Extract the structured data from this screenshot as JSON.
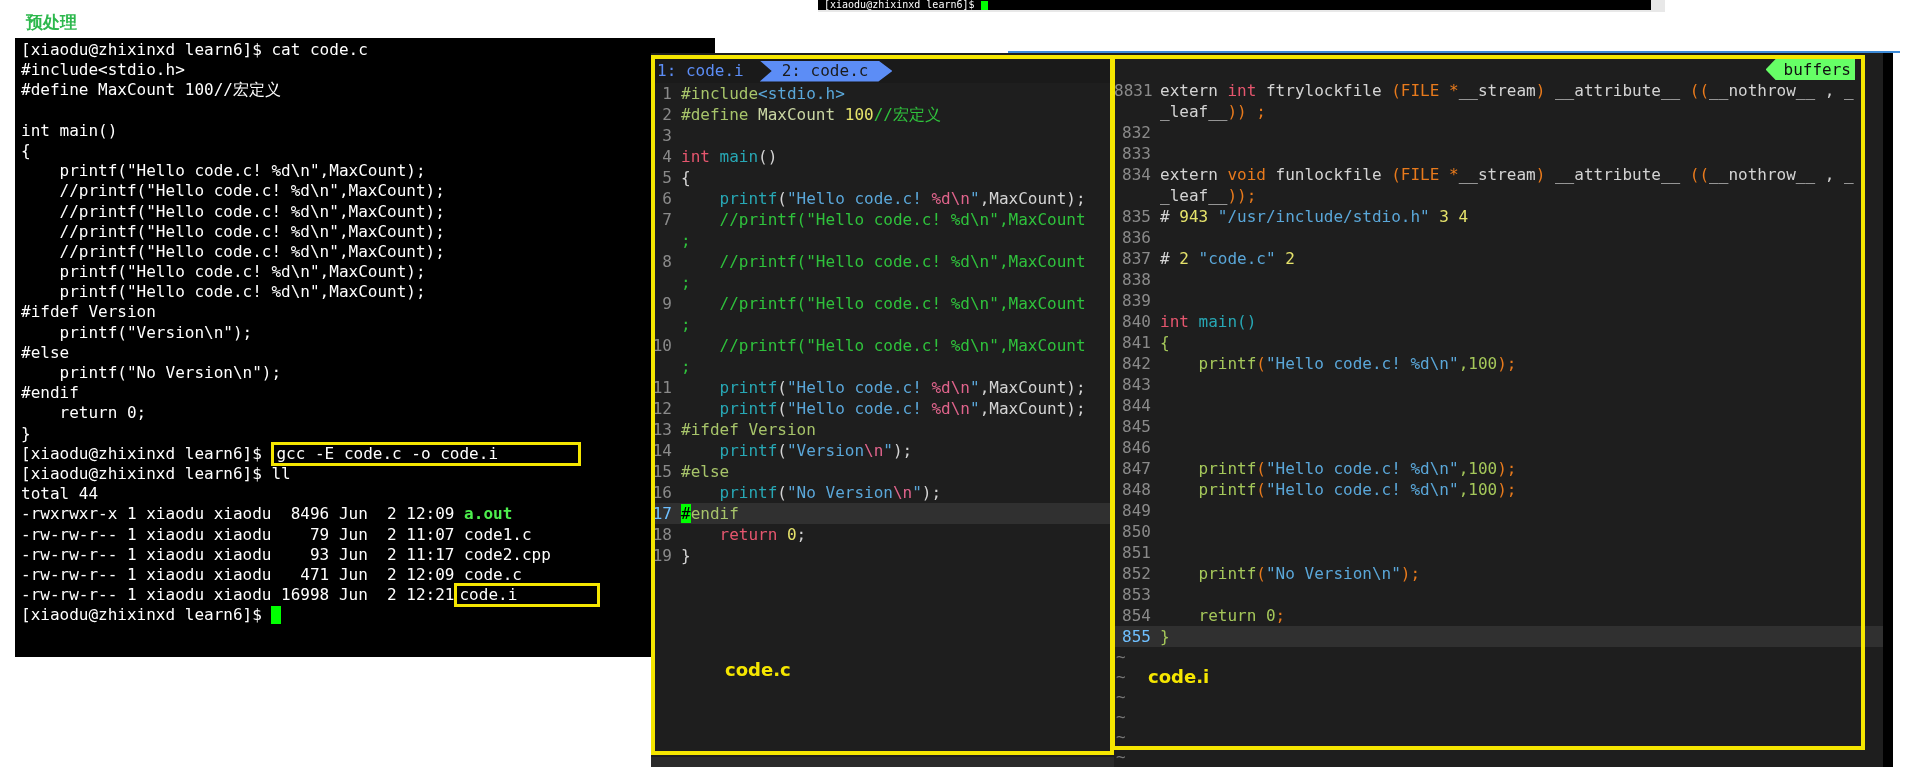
{
  "heading": "预处理",
  "top_terminal": {
    "prompt": "[xiaodu@zhixinxd learn6]$",
    "cursor": true
  },
  "terminal": {
    "lines": [
      {
        "kind": "text",
        "parts": [
          {
            "kind": "plain",
            "text": "[xiaodu@zhixinxd learn6]$ cat code.c"
          }
        ]
      },
      {
        "kind": "text",
        "parts": [
          {
            "kind": "plain",
            "text": "#include<stdio.h>"
          }
        ]
      },
      {
        "kind": "text",
        "parts": [
          {
            "kind": "plain",
            "text": "#define MaxCount 100//宏定义"
          }
        ]
      },
      {
        "kind": "blank"
      },
      {
        "kind": "text",
        "parts": [
          {
            "kind": "plain",
            "text": "int main()"
          }
        ]
      },
      {
        "kind": "text",
        "parts": [
          {
            "kind": "plain",
            "text": "{"
          }
        ]
      },
      {
        "kind": "text",
        "parts": [
          {
            "kind": "plain",
            "text": "    printf(\"Hello code.c! %d\\n\",MaxCount);"
          }
        ]
      },
      {
        "kind": "text",
        "parts": [
          {
            "kind": "plain",
            "text": "    //printf(\"Hello code.c! %d\\n\",MaxCount);"
          }
        ]
      },
      {
        "kind": "text",
        "parts": [
          {
            "kind": "plain",
            "text": "    //printf(\"Hello code.c! %d\\n\",MaxCount);"
          }
        ]
      },
      {
        "kind": "text",
        "parts": [
          {
            "kind": "plain",
            "text": "    //printf(\"Hello code.c! %d\\n\",MaxCount);"
          }
        ]
      },
      {
        "kind": "text",
        "parts": [
          {
            "kind": "plain",
            "text": "    //printf(\"Hello code.c! %d\\n\",MaxCount);"
          }
        ]
      },
      {
        "kind": "text",
        "parts": [
          {
            "kind": "plain",
            "text": "    printf(\"Hello code.c! %d\\n\",MaxCount);"
          }
        ]
      },
      {
        "kind": "text",
        "parts": [
          {
            "kind": "plain",
            "text": "    printf(\"Hello code.c! %d\\n\",MaxCount);"
          }
        ]
      },
      {
        "kind": "text",
        "parts": [
          {
            "kind": "plain",
            "text": "#ifdef Version"
          }
        ]
      },
      {
        "kind": "text",
        "parts": [
          {
            "kind": "plain",
            "text": "    printf(\"Version\\n\");"
          }
        ]
      },
      {
        "kind": "text",
        "parts": [
          {
            "kind": "plain",
            "text": "#else"
          }
        ]
      },
      {
        "kind": "text",
        "parts": [
          {
            "kind": "plain",
            "text": "    printf(\"No Version\\n\");"
          }
        ]
      },
      {
        "kind": "text",
        "parts": [
          {
            "kind": "plain",
            "text": "#endif"
          }
        ]
      },
      {
        "kind": "text",
        "parts": [
          {
            "kind": "plain",
            "text": "    return 0;"
          }
        ]
      },
      {
        "kind": "text",
        "parts": [
          {
            "kind": "plain",
            "text": "}"
          }
        ]
      },
      {
        "kind": "text",
        "parts": [
          {
            "kind": "plain",
            "text": "[xiaodu@zhixinxd learn6]$ "
          },
          {
            "kind": "boxed",
            "text": "gcc -E code.c -o code.i"
          }
        ]
      },
      {
        "kind": "text",
        "parts": [
          {
            "kind": "plain",
            "text": "[xiaodu@zhixinxd learn6]$ ll"
          }
        ]
      },
      {
        "kind": "text",
        "parts": [
          {
            "kind": "plain",
            "text": "total 44"
          }
        ]
      },
      {
        "kind": "text",
        "parts": [
          {
            "kind": "plain",
            "text": "-rwxrwxr-x 1 xiaodu xiaodu  8496 Jun  2 12:09 "
          },
          {
            "kind": "executable",
            "text": "a.out"
          }
        ]
      },
      {
        "kind": "text",
        "parts": [
          {
            "kind": "plain",
            "text": "-rw-rw-r-- 1 xiaodu xiaodu    79 Jun  2 11:07 code1.c"
          }
        ]
      },
      {
        "kind": "text",
        "parts": [
          {
            "kind": "plain",
            "text": "-rw-rw-r-- 1 xiaodu xiaodu    93 Jun  2 11:17 code2.cpp"
          }
        ]
      },
      {
        "kind": "text",
        "parts": [
          {
            "kind": "plain",
            "text": "-rw-rw-r-- 1 xiaodu xiaodu   471 Jun  2 12:09 code.c"
          }
        ]
      },
      {
        "kind": "text",
        "parts": [
          {
            "kind": "plain",
            "text": "-rw-rw-r-- 1 xiaodu xiaodu 16998 Jun  2 12:21"
          },
          {
            "kind": "boxed",
            "text": "code.i"
          }
        ]
      },
      {
        "kind": "text",
        "cursor": true,
        "parts": [
          {
            "kind": "plain",
            "text": "[xiaodu@zhixinxd learn6]$ "
          }
        ]
      }
    ]
  },
  "code_editor": {
    "tabs": [
      {
        "label": "1: code.i",
        "selected": false
      },
      {
        "label": "2: code.c",
        "selected": true
      }
    ],
    "lines": [
      {
        "kind": "line",
        "number": "1",
        "current": false,
        "tokens": [
          {
            "kind": "preproc",
            "text": "#include"
          },
          {
            "kind": "string",
            "text": "<stdio.h>"
          }
        ]
      },
      {
        "kind": "line",
        "number": "2",
        "current": false,
        "tokens": [
          {
            "kind": "preproc",
            "text": "#define "
          },
          {
            "kind": "macro",
            "text": "MaxCount "
          },
          {
            "kind": "number",
            "text": "100"
          },
          {
            "kind": "comment",
            "text": "//宏定义"
          }
        ]
      },
      {
        "kind": "line",
        "number": "3",
        "current": false
      },
      {
        "kind": "line",
        "number": "4",
        "current": false,
        "tokens": [
          {
            "kind": "type",
            "text": "int "
          },
          {
            "kind": "func",
            "text": "main"
          },
          {
            "kind": "plain",
            "text": "()"
          }
        ]
      },
      {
        "kind": "line",
        "number": "5",
        "current": false,
        "tokens": [
          {
            "kind": "plain",
            "text": "{"
          }
        ]
      },
      {
        "kind": "line",
        "number": "6",
        "current": false,
        "tokens": [
          {
            "kind": "func",
            "text": "    printf"
          },
          {
            "kind": "plain",
            "text": "("
          },
          {
            "kind": "string",
            "text": "\"Hello code.c! "
          },
          {
            "kind": "escape",
            "text": "%d\\n"
          },
          {
            "kind": "string",
            "text": "\""
          },
          {
            "kind": "plain",
            "text": ",MaxCount);"
          }
        ]
      },
      {
        "kind": "line",
        "number": "7",
        "current": false,
        "tokens": [
          {
            "kind": "comment",
            "text": "    //printf(\"Hello code.c! %d\\n\",MaxCount"
          }
        ]
      },
      {
        "kind": "wrap",
        "current": false,
        "tokens": [
          {
            "kind": "comment",
            "text": ";"
          }
        ]
      },
      {
        "kind": "line",
        "number": "8",
        "current": false,
        "tokens": [
          {
            "kind": "comment",
            "text": "    //printf(\"Hello code.c! %d\\n\",MaxCount"
          }
        ]
      },
      {
        "kind": "wrap",
        "current": false,
        "tokens": [
          {
            "kind": "comment",
            "text": ";"
          }
        ]
      },
      {
        "kind": "line",
        "number": "9",
        "current": false,
        "tokens": [
          {
            "kind": "comment",
            "text": "    //printf(\"Hello code.c! %d\\n\",MaxCount"
          }
        ]
      },
      {
        "kind": "wrap",
        "current": false,
        "tokens": [
          {
            "kind": "comment",
            "text": ";"
          }
        ]
      },
      {
        "kind": "line",
        "number": "10",
        "current": false,
        "tokens": [
          {
            "kind": "comment",
            "text": "    //printf(\"Hello code.c! %d\\n\",MaxCount"
          }
        ]
      },
      {
        "kind": "wrap",
        "current": false,
        "tokens": [
          {
            "kind": "comment",
            "text": ";"
          }
        ]
      },
      {
        "kind": "line",
        "number": "11",
        "current": false,
        "tokens": [
          {
            "kind": "func",
            "text": "    printf"
          },
          {
            "kind": "plain",
            "text": "("
          },
          {
            "kind": "string",
            "text": "\"Hello code.c! "
          },
          {
            "kind": "escape",
            "text": "%d\\n"
          },
          {
            "kind": "string",
            "text": "\""
          },
          {
            "kind": "plain",
            "text": ",MaxCount);"
          }
        ]
      },
      {
        "kind": "line",
        "number": "12",
        "current": false,
        "tokens": [
          {
            "kind": "func",
            "text": "    printf"
          },
          {
            "kind": "plain",
            "text": "("
          },
          {
            "kind": "string",
            "text": "\"Hello code.c! "
          },
          {
            "kind": "escape",
            "text": "%d\\n"
          },
          {
            "kind": "string",
            "text": "\""
          },
          {
            "kind": "plain",
            "text": ",MaxCount);"
          }
        ]
      },
      {
        "kind": "line",
        "number": "13",
        "current": false,
        "tokens": [
          {
            "kind": "preproc",
            "text": "#ifdef Version"
          }
        ]
      },
      {
        "kind": "line",
        "number": "14",
        "current": false,
        "tokens": [
          {
            "kind": "func",
            "text": "    printf"
          },
          {
            "kind": "plain",
            "text": "("
          },
          {
            "kind": "string",
            "text": "\"Version"
          },
          {
            "kind": "escape",
            "text": "\\n"
          },
          {
            "kind": "string",
            "text": "\""
          },
          {
            "kind": "plain",
            "text": ");"
          }
        ]
      },
      {
        "kind": "line",
        "number": "15",
        "current": false,
        "tokens": [
          {
            "kind": "preproc",
            "text": "#else"
          }
        ]
      },
      {
        "kind": "line",
        "number": "16",
        "current": false,
        "tokens": [
          {
            "kind": "func",
            "text": "    printf"
          },
          {
            "kind": "plain",
            "text": "("
          },
          {
            "kind": "string",
            "text": "\"No Version"
          },
          {
            "kind": "escape",
            "text": "\\n"
          },
          {
            "kind": "string",
            "text": "\""
          },
          {
            "kind": "plain",
            "text": ");"
          }
        ]
      },
      {
        "kind": "line",
        "number": "17",
        "current": true,
        "tokens": [
          {
            "kind": "cursor",
            "text": "#"
          },
          {
            "kind": "preproc",
            "text": "endif"
          }
        ]
      },
      {
        "kind": "line",
        "number": "18",
        "current": false,
        "tokens": [
          {
            "kind": "type",
            "text": "    return "
          },
          {
            "kind": "number",
            "text": "0"
          },
          {
            "kind": "plain",
            "text": ";"
          }
        ]
      },
      {
        "kind": "line",
        "number": "19",
        "current": false,
        "tokens": [
          {
            "kind": "plain",
            "text": "}"
          }
        ]
      }
    ],
    "annotation": "code.c"
  },
  "preprocessed_view": {
    "tag": "buffers",
    "lines": [
      {
        "kind": "line",
        "number": "8831",
        "current": false,
        "tokens": [
          {
            "kind": "plain",
            "text": "extern "
          },
          {
            "kind": "type",
            "text": "int"
          },
          {
            "kind": "plain",
            "text": " ftrylockfile "
          },
          {
            "kind": "op",
            "text": "(FILE *"
          },
          {
            "kind": "plain",
            "text": "__stream"
          },
          {
            "kind": "op",
            "text": ")"
          },
          {
            "kind": "plain",
            "text": " __attribute__ "
          },
          {
            "kind": "op",
            "text": "(("
          },
          {
            "kind": "plain",
            "text": "__nothrow__ , _"
          }
        ]
      },
      {
        "kind": "wrap",
        "current": false,
        "tokens": [
          {
            "kind": "plain",
            "text": "_leaf__"
          },
          {
            "kind": "op",
            "text": ")) ;"
          }
        ]
      },
      {
        "kind": "line",
        "number": "832",
        "current": false
      },
      {
        "kind": "line",
        "number": "833",
        "current": false
      },
      {
        "kind": "line",
        "number": "834",
        "current": false,
        "tokens": [
          {
            "kind": "plain",
            "text": "extern "
          },
          {
            "kind": "op",
            "text": "void"
          },
          {
            "kind": "plain",
            "text": " funlockfile "
          },
          {
            "kind": "op",
            "text": "(FILE *"
          },
          {
            "kind": "plain",
            "text": "__stream"
          },
          {
            "kind": "op",
            "text": ")"
          },
          {
            "kind": "plain",
            "text": " __attribute__ "
          },
          {
            "kind": "op",
            "text": "(("
          },
          {
            "kind": "plain",
            "text": "__nothrow__ , _"
          }
        ]
      },
      {
        "kind": "wrap",
        "current": false,
        "tokens": [
          {
            "kind": "plain",
            "text": "_leaf__"
          },
          {
            "kind": "op",
            "text": "));"
          }
        ]
      },
      {
        "kind": "line",
        "number": "835",
        "current": false,
        "tokens": [
          {
            "kind": "plain",
            "text": "# "
          },
          {
            "kind": "number",
            "text": "943 "
          },
          {
            "kind": "string",
            "text": "\"/usr/include/stdio.h\""
          },
          {
            "kind": "number",
            "text": " 3 4"
          }
        ]
      },
      {
        "kind": "line",
        "number": "836",
        "current": false
      },
      {
        "kind": "line",
        "number": "837",
        "current": false,
        "tokens": [
          {
            "kind": "plain",
            "text": "# "
          },
          {
            "kind": "number",
            "text": "2 "
          },
          {
            "kind": "string",
            "text": "\"code.c\""
          },
          {
            "kind": "number",
            "text": " 2"
          }
        ]
      },
      {
        "kind": "line",
        "number": "838",
        "current": false
      },
      {
        "kind": "line",
        "number": "839",
        "current": false
      },
      {
        "kind": "line",
        "number": "840",
        "current": false,
        "tokens": [
          {
            "kind": "type",
            "text": "int "
          },
          {
            "kind": "func",
            "text": "main()"
          }
        ]
      },
      {
        "kind": "line",
        "number": "841",
        "current": false,
        "tokens": [
          {
            "kind": "call",
            "text": "{"
          }
        ]
      },
      {
        "kind": "line",
        "number": "842",
        "current": false,
        "tokens": [
          {
            "kind": "call",
            "text": "    printf"
          },
          {
            "kind": "op",
            "text": "("
          },
          {
            "kind": "string",
            "text": "\"Hello code.c! %d\\n\""
          },
          {
            "kind": "call",
            "text": ",100"
          },
          {
            "kind": "op",
            "text": ");"
          }
        ]
      },
      {
        "kind": "line",
        "number": "843",
        "current": false
      },
      {
        "kind": "line",
        "number": "844",
        "current": false
      },
      {
        "kind": "line",
        "number": "845",
        "current": false
      },
      {
        "kind": "line",
        "number": "846",
        "current": false
      },
      {
        "kind": "line",
        "number": "847",
        "current": false,
        "tokens": [
          {
            "kind": "call",
            "text": "    printf"
          },
          {
            "kind": "op",
            "text": "("
          },
          {
            "kind": "string",
            "text": "\"Hello code.c! %d\\n\""
          },
          {
            "kind": "call",
            "text": ",100"
          },
          {
            "kind": "op",
            "text": ");"
          }
        ]
      },
      {
        "kind": "line",
        "number": "848",
        "current": false,
        "tokens": [
          {
            "kind": "call",
            "text": "    printf"
          },
          {
            "kind": "op",
            "text": "("
          },
          {
            "kind": "string",
            "text": "\"Hello code.c! %d\\n\""
          },
          {
            "kind": "call",
            "text": ",100"
          },
          {
            "kind": "op",
            "text": ");"
          }
        ]
      },
      {
        "kind": "line",
        "number": "849",
        "current": false
      },
      {
        "kind": "line",
        "number": "850",
        "current": false
      },
      {
        "kind": "line",
        "number": "851",
        "current": false
      },
      {
        "kind": "line",
        "number": "852",
        "current": false,
        "tokens": [
          {
            "kind": "call",
            "text": "    printf"
          },
          {
            "kind": "op",
            "text": "("
          },
          {
            "kind": "string",
            "text": "\"No Version\\n\""
          },
          {
            "kind": "op",
            "text": ");"
          }
        ]
      },
      {
        "kind": "line",
        "number": "853",
        "current": false
      },
      {
        "kind": "line",
        "number": "854",
        "current": false,
        "tokens": [
          {
            "kind": "call",
            "text": "    return 0"
          },
          {
            "kind": "op",
            "text": ";"
          }
        ]
      },
      {
        "kind": "line",
        "number": "855",
        "current": true,
        "tokens": [
          {
            "kind": "call",
            "text": "}"
          }
        ]
      }
    ],
    "tilde_rows": [
      "~",
      "~",
      "~",
      "~",
      "~",
      "~"
    ],
    "annotation": "code.i"
  }
}
